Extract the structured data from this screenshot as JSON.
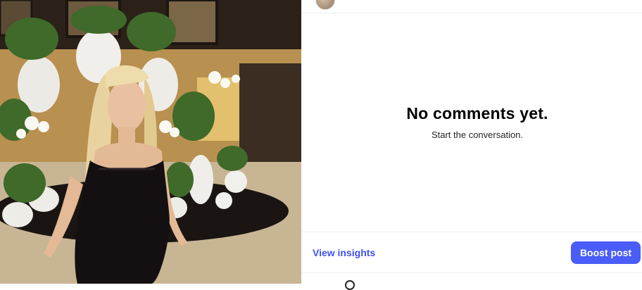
{
  "comments": {
    "empty_title": "No comments yet.",
    "empty_subtitle": "Start the conversation."
  },
  "actions": {
    "insights_label": "View insights",
    "boost_label": "Boost post"
  },
  "colors": {
    "accent": "#4150f7",
    "boost_button": "#4a5df9",
    "divider": "#efefef"
  },
  "icons": {
    "avatar": "profile-avatar",
    "bottom": "circle-icon"
  }
}
